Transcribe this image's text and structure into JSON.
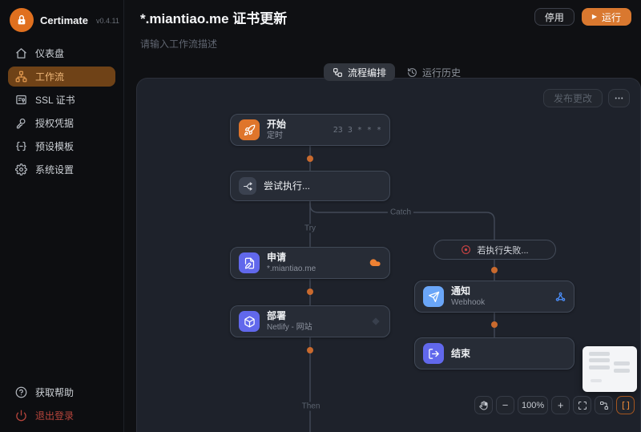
{
  "app": {
    "name": "Certimate",
    "version": "v0.4.11"
  },
  "sidebar": {
    "items": [
      {
        "label": "仪表盘",
        "icon": "dashboard-icon"
      },
      {
        "label": "工作流",
        "icon": "workflow-icon",
        "active": true
      },
      {
        "label": "SSL 证书",
        "icon": "certificate-icon"
      },
      {
        "label": "授权凭据",
        "icon": "credentials-icon"
      },
      {
        "label": "预设模板",
        "icon": "template-icon"
      },
      {
        "label": "系统设置",
        "icon": "settings-icon"
      }
    ],
    "footer": [
      {
        "label": "获取帮助",
        "icon": "help-icon"
      },
      {
        "label": "退出登录",
        "icon": "power-icon"
      }
    ]
  },
  "header": {
    "title": "*.miantiao.me 证书更新",
    "description_placeholder": "请输入工作流描述",
    "stop_label": "停用",
    "run_label": "运行"
  },
  "tabs": [
    {
      "label": "流程编排",
      "active": true
    },
    {
      "label": "运行历史",
      "active": false
    }
  ],
  "canvas": {
    "publish_label": "发布更改",
    "zoom_level": "100%",
    "labels": {
      "try": "Try",
      "catch": "Catch",
      "then": "Then"
    },
    "nodes": {
      "start": {
        "title": "开始",
        "subtitle": "定时",
        "meta": "23 3 * * *"
      },
      "try": {
        "title": "尝试执行..."
      },
      "apply": {
        "title": "申请",
        "subtitle": "*.miantiao.me",
        "provider_icon": "cloudflare-icon"
      },
      "deploy": {
        "title": "部署",
        "subtitle": "Netlify - 网站"
      },
      "failure": {
        "title": "若执行失败..."
      },
      "notify": {
        "title": "通知",
        "subtitle": "Webhook",
        "provider_icon": "webhook-icon"
      },
      "end": {
        "title": "结束"
      }
    }
  },
  "colors": {
    "accent": "#d9782f",
    "active_nav_bg": "#6f4217",
    "indigo": "#6168ec",
    "light_blue": "#6aa6f8",
    "failure_red": "#cf4444",
    "cloudflare_orange": "#ee8133",
    "canvas_bg": "#1e222b"
  }
}
